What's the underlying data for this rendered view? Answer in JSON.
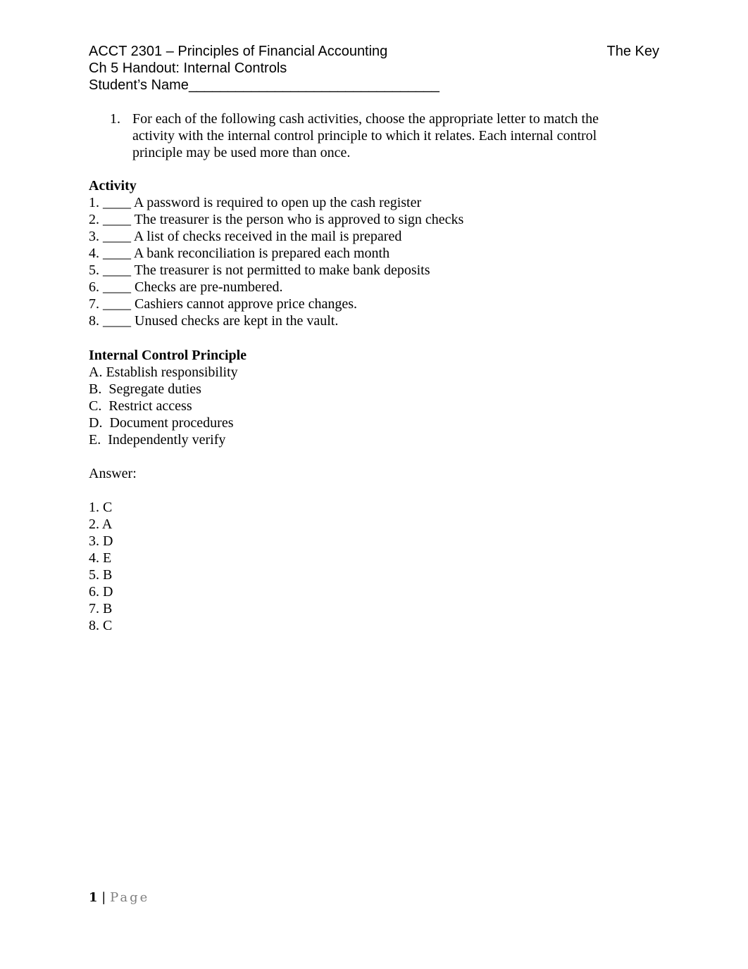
{
  "header": {
    "course": "ACCT 2301 – Principles of Financial Accounting",
    "key_label": "The Key",
    "handout": "Ch 5 Handout: Internal Controls",
    "student_name_label": "Student’s Name",
    "student_name_blank": "________________________________"
  },
  "question": {
    "number": "1.",
    "text": "For each of the following cash activities, choose the appropriate letter to match the activity with the internal control principle to which it relates. Each internal control principle may be used more than once."
  },
  "activity": {
    "heading": "Activity",
    "items": [
      {
        "num": "1.",
        "blank": "____",
        "text": "A password is required to open up the cash register"
      },
      {
        "num": "2.",
        "blank": "____",
        "text": "The treasurer is the person who is approved to sign checks"
      },
      {
        "num": "3.",
        "blank": "____",
        "text": "A list of checks received in the mail is prepared"
      },
      {
        "num": "4.",
        "blank": "____",
        "text": "A bank reconciliation is prepared each month"
      },
      {
        "num": "5.",
        "blank": "____",
        "text": "The treasurer is not permitted to make bank deposits"
      },
      {
        "num": "6.",
        "blank": "____",
        "text": "Checks are pre-numbered."
      },
      {
        "num": "7.",
        "blank": "____",
        "text": "Cashiers cannot approve price changes."
      },
      {
        "num": "8.",
        "blank": "____",
        "text": "Unused checks are kept in the vault."
      }
    ]
  },
  "principles": {
    "heading": "Internal Control Principle",
    "items": [
      "A. Establish responsibility",
      "B.  Segregate duties",
      "C.  Restrict access",
      "D.  Document procedures",
      "E.  Independently verify"
    ]
  },
  "answer": {
    "label": "Answer:",
    "items": [
      "1. C",
      "2. A",
      "3. D",
      "4. E",
      "5. B",
      "6. D",
      "7. B",
      "8. C"
    ]
  },
  "footer": {
    "page_number": "1",
    "separator": "|",
    "page_word": "Page"
  }
}
